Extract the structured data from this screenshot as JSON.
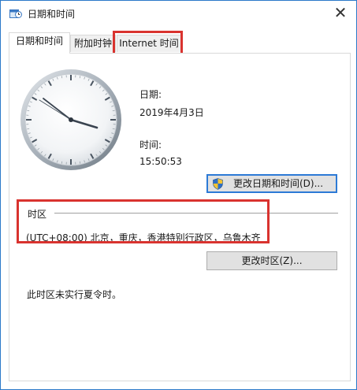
{
  "window": {
    "title": "日期和时间",
    "close_glyph": "✕"
  },
  "tabs": [
    {
      "label": "日期和时间",
      "active": true
    },
    {
      "label": "附加时钟",
      "active": false
    },
    {
      "label": "Internet 时间",
      "active": false
    }
  ],
  "datetime": {
    "date_label": "日期:",
    "date_value": "2019年4月3日",
    "time_label": "时间:",
    "time_value": "15:50:53",
    "change_button": "更改日期和时间(D)..."
  },
  "timezone": {
    "section_label": "时区",
    "value": "(UTC+08:00) 北京，重庆，香港特别行政区，乌鲁木齐",
    "change_button": "更改时区(Z)...",
    "dst_note": "此时区未实行夏令时。"
  },
  "icons": {
    "app": "date-time-icon",
    "close": "close-icon",
    "shield": "uac-shield-icon"
  },
  "colors": {
    "window_border": "#2b79c9",
    "highlight": "#d9332f",
    "focus_border": "#2c7ad6",
    "button_bg": "#e1e1e1"
  }
}
